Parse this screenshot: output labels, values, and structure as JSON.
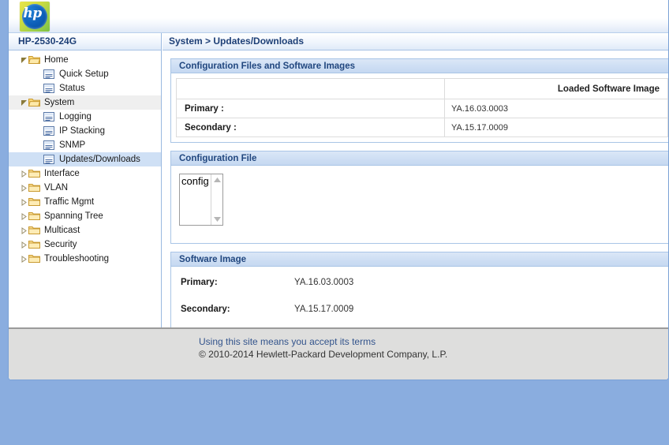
{
  "brand": {
    "logo_icon": "hp-logo-icon",
    "logo_text": "hp",
    "accent_blue": "#1d3f76",
    "page_background": "#8aaddf",
    "panel_header_blue": "#c5d8f1",
    "selected_item_blue": "#cfe0f5"
  },
  "sidebar": {
    "device_title": "HP-2530-24G",
    "tree": [
      {
        "label": "Home",
        "type": "folder",
        "state": "expanded",
        "depth": 0,
        "icon": "folder-open-icon",
        "arrow": "triangle-expanded-icon",
        "highlight": "none"
      },
      {
        "label": "Quick Setup",
        "type": "page",
        "state": "leaf",
        "depth": 1,
        "icon": "page-icon",
        "arrow": "none",
        "highlight": "none"
      },
      {
        "label": "Status",
        "type": "page",
        "state": "leaf",
        "depth": 1,
        "icon": "page-icon",
        "arrow": "none",
        "highlight": "none"
      },
      {
        "label": "System",
        "type": "folder",
        "state": "expanded",
        "depth": 0,
        "icon": "folder-open-icon",
        "arrow": "triangle-expanded-icon",
        "highlight": "gray"
      },
      {
        "label": "Logging",
        "type": "page",
        "state": "leaf",
        "depth": 1,
        "icon": "page-icon",
        "arrow": "none",
        "highlight": "none"
      },
      {
        "label": "IP Stacking",
        "type": "page",
        "state": "leaf",
        "depth": 1,
        "icon": "page-icon",
        "arrow": "none",
        "highlight": "none"
      },
      {
        "label": "SNMP",
        "type": "page",
        "state": "leaf",
        "depth": 1,
        "icon": "page-icon",
        "arrow": "none",
        "highlight": "none"
      },
      {
        "label": "Updates/Downloads",
        "type": "page",
        "state": "leaf",
        "depth": 1,
        "icon": "page-icon",
        "arrow": "none",
        "highlight": "blue"
      },
      {
        "label": "Interface",
        "type": "folder",
        "state": "collapsed",
        "depth": 0,
        "icon": "folder-closed-icon",
        "arrow": "triangle-collapsed-icon",
        "highlight": "none"
      },
      {
        "label": "VLAN",
        "type": "folder",
        "state": "collapsed",
        "depth": 0,
        "icon": "folder-closed-icon",
        "arrow": "triangle-collapsed-icon",
        "highlight": "none"
      },
      {
        "label": "Traffic Mgmt",
        "type": "folder",
        "state": "collapsed",
        "depth": 0,
        "icon": "folder-closed-icon",
        "arrow": "triangle-collapsed-icon",
        "highlight": "none"
      },
      {
        "label": "Spanning Tree",
        "type": "folder",
        "state": "collapsed",
        "depth": 0,
        "icon": "folder-closed-icon",
        "arrow": "triangle-collapsed-icon",
        "highlight": "none"
      },
      {
        "label": "Multicast",
        "type": "folder",
        "state": "collapsed",
        "depth": 0,
        "icon": "folder-closed-icon",
        "arrow": "triangle-collapsed-icon",
        "highlight": "none"
      },
      {
        "label": "Security",
        "type": "folder",
        "state": "collapsed",
        "depth": 0,
        "icon": "folder-closed-icon",
        "arrow": "triangle-collapsed-icon",
        "highlight": "none"
      },
      {
        "label": "Troubleshooting",
        "type": "folder",
        "state": "collapsed",
        "depth": 0,
        "icon": "folder-closed-icon",
        "arrow": "triangle-collapsed-icon",
        "highlight": "none"
      }
    ]
  },
  "content": {
    "breadcrumb": "System > Updates/Downloads",
    "panels": {
      "config_and_images": {
        "title": "Configuration Files and Software Images",
        "table": {
          "headers": [
            "",
            "Loaded Software Image"
          ],
          "rows": [
            {
              "label": "Primary :",
              "value": "YA.16.03.0003"
            },
            {
              "label": "Secondary :",
              "value": "YA.15.17.0009"
            }
          ]
        }
      },
      "configuration_file": {
        "title": "Configuration File",
        "listbox": {
          "name": "config-file-list",
          "options": [
            "config"
          ],
          "selected": "config",
          "scroll_up_icon": "scroll-up-arrow-icon",
          "scroll_down_icon": "scroll-down-arrow-icon"
        }
      },
      "software_image": {
        "title": "Software Image",
        "rows": [
          {
            "label": "Primary:",
            "value": "YA.16.03.0003"
          },
          {
            "label": "Secondary:",
            "value": "YA.15.17.0009"
          }
        ]
      }
    }
  },
  "footer": {
    "terms_link": "Using this site means you accept its terms",
    "copyright": "© 2010-2014 Hewlett-Packard Development Company, L.P."
  }
}
